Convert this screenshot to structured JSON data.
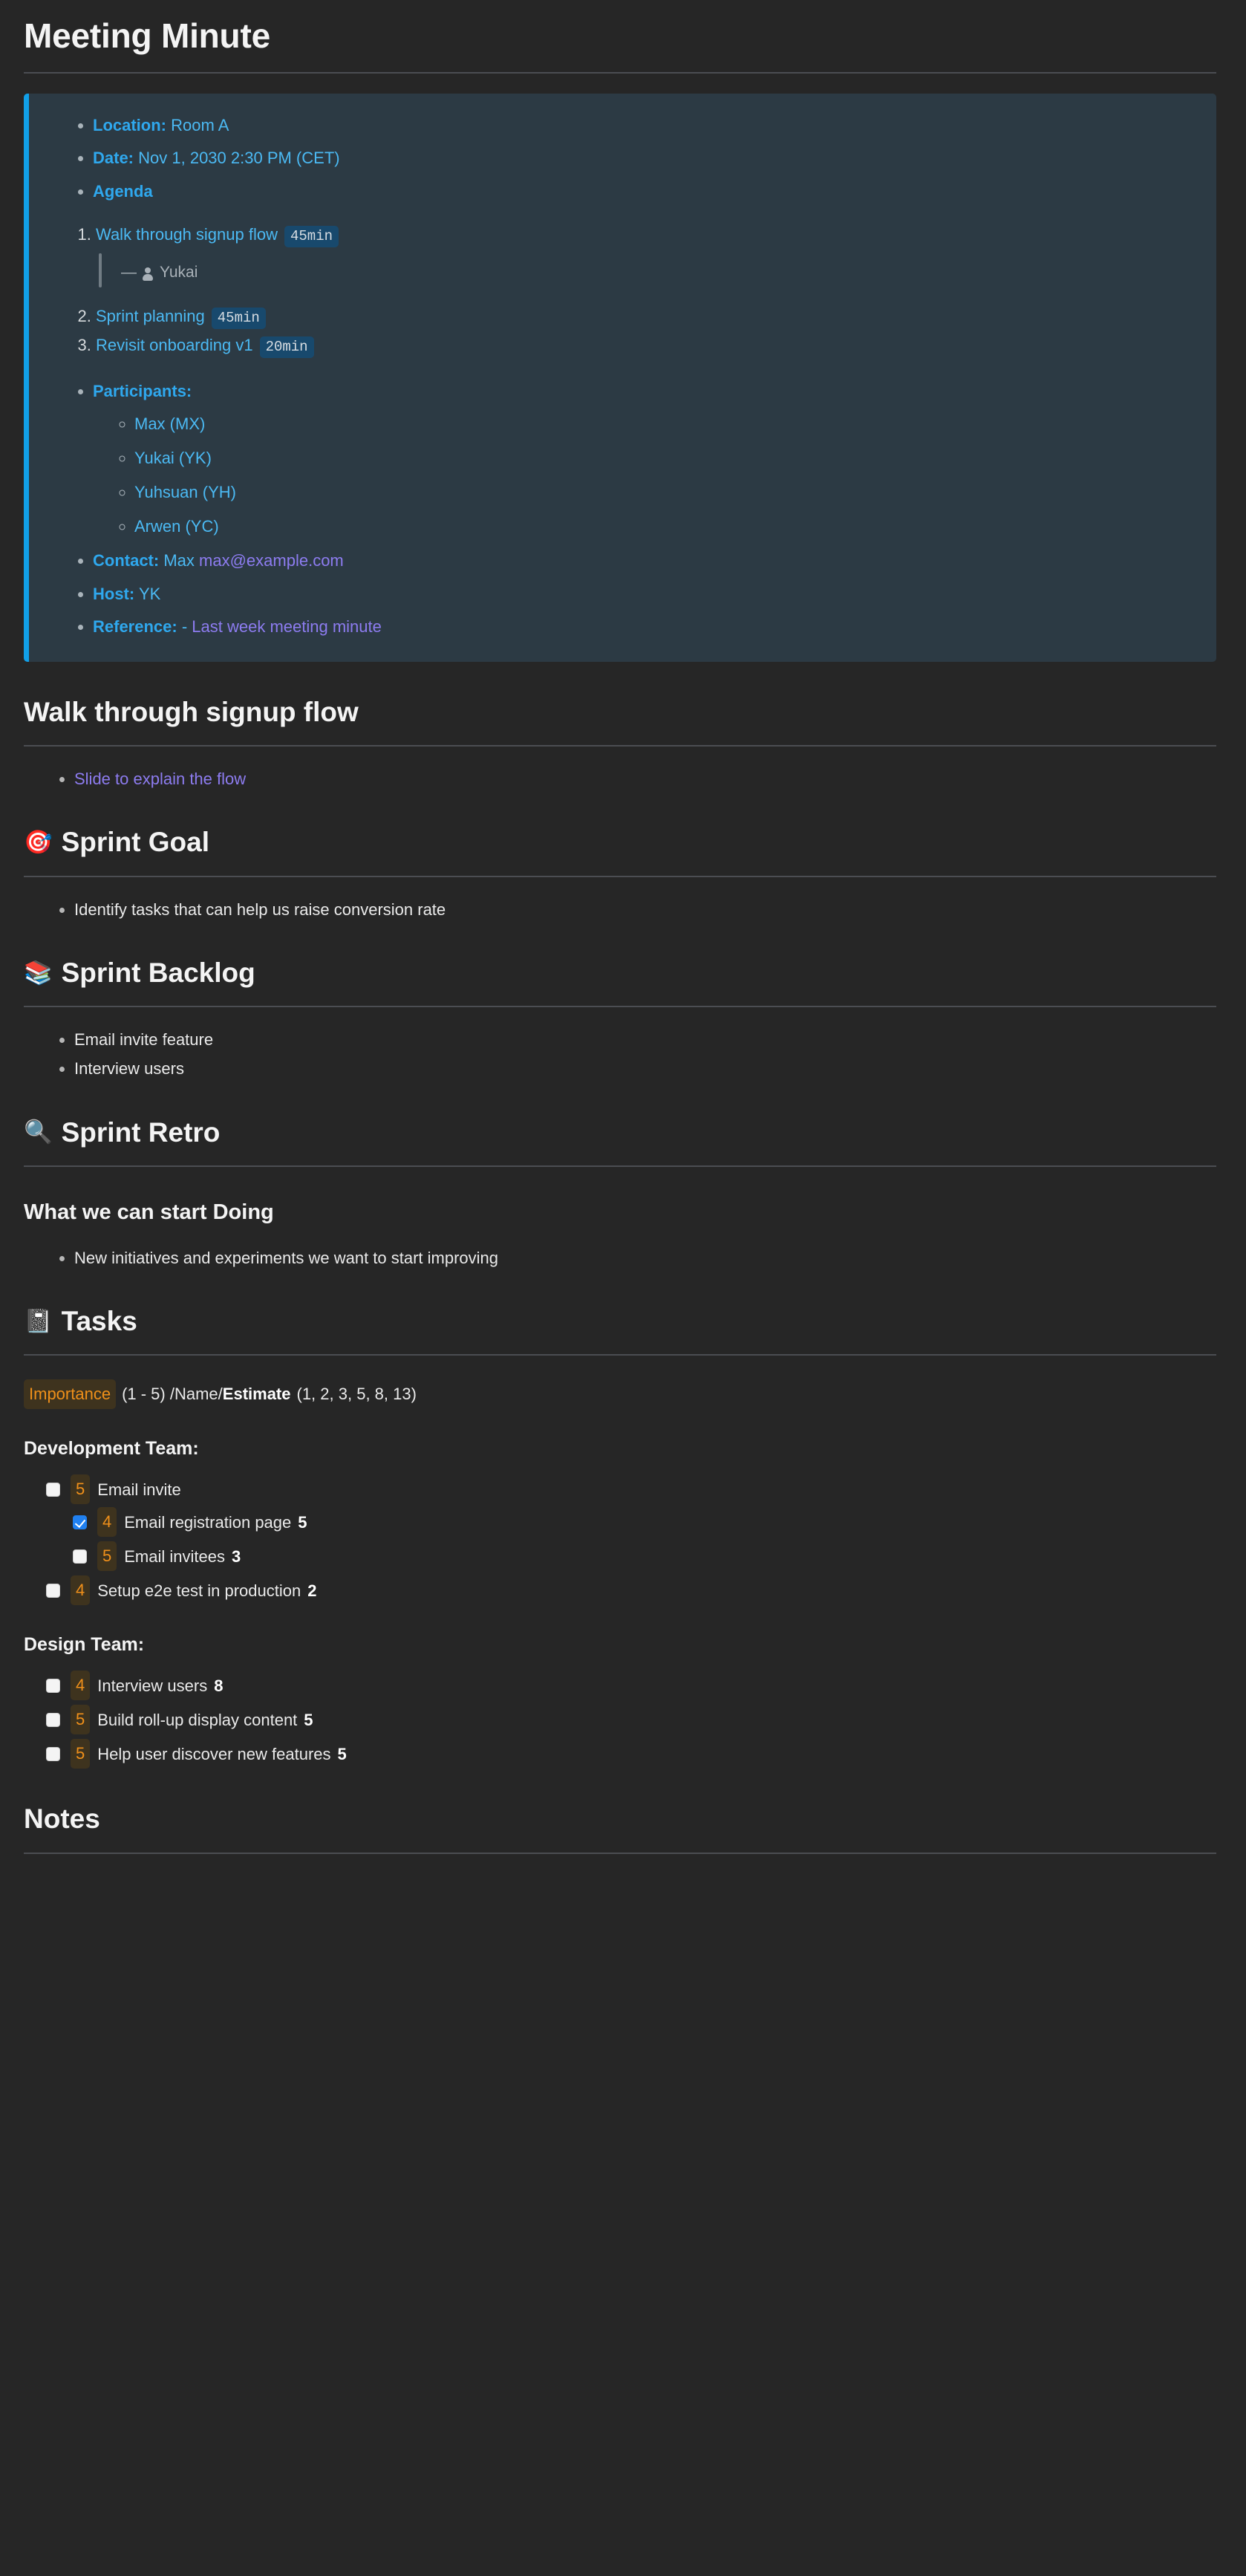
{
  "document": {
    "title": "Meeting Minute"
  },
  "callout": {
    "accent_color": "#11a0e8",
    "background_color": "#2c3a44",
    "info": [
      {
        "label": "Location:",
        "value": "Room A"
      },
      {
        "label": "Date:",
        "value": "Nov 1, 2030 2:30 PM (CET)"
      },
      {
        "label": "Agenda",
        "value": ""
      }
    ],
    "agenda": [
      {
        "index": "1.",
        "title": "Walk through signup flow",
        "duration": "45min",
        "note": {
          "dash": "—",
          "person": "Yukai"
        }
      },
      {
        "index": "2.",
        "title": "Sprint planning",
        "duration": "45min",
        "note": null
      },
      {
        "index": "3.",
        "title": "Revisit onboarding v1",
        "duration": "20min",
        "note": null
      }
    ],
    "participants_label": "Participants:",
    "participants": [
      "Max (MX)",
      "Yukai (YK)",
      "Yuhsuan (YH)",
      "Arwen (YC)"
    ],
    "contact": {
      "label": "Contact:",
      "name": "Max",
      "email": "max@example.com"
    },
    "host": {
      "label": "Host:",
      "value": "YK"
    },
    "reference": {
      "label": "Reference:",
      "dash": "-",
      "value": "Last week meeting minute"
    }
  },
  "sections": {
    "walkthrough": {
      "heading": "Walk through signup flow",
      "emoji": "",
      "items": [
        "Slide to explain the flow"
      ]
    },
    "sprint_goal": {
      "heading": "Sprint Goal",
      "emoji": "🎯",
      "emoji_name": "dart-target-icon",
      "items": [
        "Identify tasks that can help us raise conversion rate"
      ]
    },
    "sprint_backlog": {
      "heading": "Sprint Backlog",
      "emoji": "📚",
      "emoji_name": "books-icon",
      "items": [
        "Email invite feature",
        "Interview users"
      ]
    },
    "sprint_retro": {
      "heading": "Sprint Retro",
      "emoji": "🔍",
      "emoji_name": "magnifying-glass-icon"
    },
    "start_doing": {
      "heading": "What we can start Doing",
      "items": [
        "New initiatives and experiments we want to start improving"
      ]
    },
    "tasks": {
      "heading": "Tasks",
      "emoji": "📓",
      "emoji_name": "notebook-icon",
      "legend": {
        "importance_label": "Importance",
        "importance_range": "(1 - 5) / ",
        "name_label": "Name",
        "separator": " / ",
        "estimate_label": "Estimate",
        "estimate_range": "(1, 2, 3, 5, 8, 13)"
      },
      "teams": [
        {
          "name": "Development Team:",
          "items": [
            {
              "checked": false,
              "importance": "5",
              "name": "Email invite",
              "estimate": "",
              "children": [
                {
                  "checked": true,
                  "importance": "4",
                  "name": "Email registration page",
                  "estimate": "5"
                },
                {
                  "checked": false,
                  "importance": "5",
                  "name": "Email invitees",
                  "estimate": "3"
                }
              ]
            },
            {
              "checked": false,
              "importance": "4",
              "name": "Setup e2e test in production",
              "estimate": "2",
              "children": []
            }
          ]
        },
        {
          "name": "Design Team:",
          "items": [
            {
              "checked": false,
              "importance": "4",
              "name": "Interview users",
              "estimate": "8",
              "children": []
            },
            {
              "checked": false,
              "importance": "5",
              "name": "Build roll-up display content",
              "estimate": "5",
              "children": []
            },
            {
              "checked": false,
              "importance": "5",
              "name": "Help user discover new features",
              "estimate": "5",
              "children": []
            }
          ]
        }
      ]
    },
    "notes": {
      "heading": "Notes"
    }
  },
  "colors": {
    "page_background": "#262626",
    "accent_blue": "#11a0e8",
    "link_blue": "#45b6f2",
    "purple": "#8d7cf0",
    "orange": "#f0901a",
    "checkbox_checked": "#2080f0",
    "code_badge_bg": "#18496d"
  }
}
